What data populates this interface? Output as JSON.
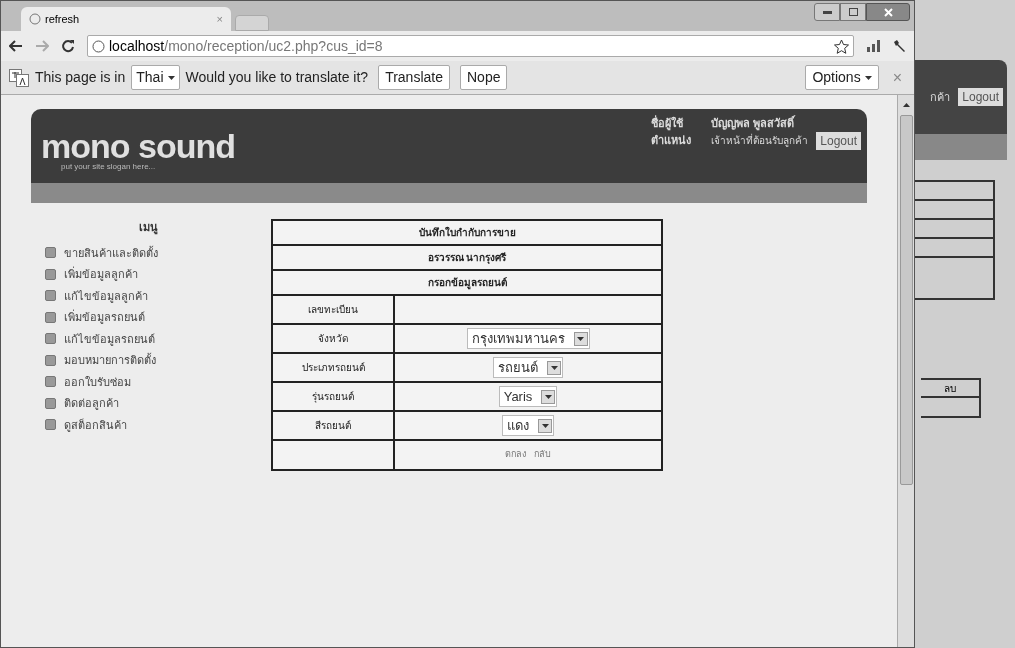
{
  "browser": {
    "tab": {
      "title": "refresh",
      "close": "×"
    },
    "url_host": "localhost",
    "url_path": "/mono/reception/uc2.php?cus_id=8",
    "translate_bar": {
      "prefix": "This page is in",
      "language": "Thai",
      "question": "Would you like to translate it?",
      "buttons": [
        "Translate",
        "Nope"
      ],
      "options": "Options",
      "close": "×"
    }
  },
  "site": {
    "logo": "mono sound",
    "slogan": "put your site slogan here...",
    "user_label": "ชื่อผู้ใช้",
    "user_name": "บัญญพล พูลสวัสดิ์",
    "role_label": "ตำแหน่ง",
    "role": "เจ้าหน้าที่ต้อนรับลูกค้า",
    "logout": "Logout"
  },
  "menu": {
    "title": "เมนู",
    "items": [
      "ขายสินค้าและติดตั้ง",
      "เพิ่มข้อมูลลูกค้า",
      "แก้ไขข้อมูลลูกค้า",
      "เพิ่มข้อมูลรถยนต์",
      "แก้ไขข้อมูลรถยนต์",
      "มอบหมายการติดตั้ง",
      "ออกใบรับซ่อม",
      "ติดต่อลูกค้า",
      "ดูสต็อกสินค้า"
    ]
  },
  "form": {
    "title": "บันทึกใบกำกับการขาย",
    "customer": "อรวรรณ นากรุงศรี",
    "section": "กรอกข้อมูลรถยนต์",
    "fields": [
      {
        "label": "เลขทะเบียน",
        "kind": "blank"
      },
      {
        "label": "จังหวัด",
        "kind": "select",
        "value": "กรุงเทพมหานคร"
      },
      {
        "label": "ประเภทรถยนต์",
        "kind": "select",
        "value": "รถยนต์"
      },
      {
        "label": "รุ่นรถยนต์",
        "kind": "select",
        "value": "Yaris"
      },
      {
        "label": "สีรถยนต์",
        "kind": "select",
        "value": "แดง"
      }
    ],
    "actions": [
      "ตกลง",
      "กลับ"
    ]
  },
  "background_window": {
    "header_text": "กค้า",
    "logout": "Logout",
    "column": "ลบ"
  }
}
